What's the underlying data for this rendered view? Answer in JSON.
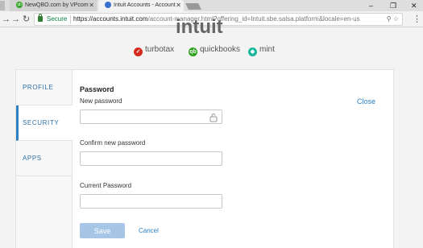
{
  "browser": {
    "tabs": [
      {
        "label": "NewQBO.com by VPcom",
        "favicon": "qb-circle-icon",
        "favicon_text": "qb"
      },
      {
        "label": "Intuit Accounts - Account",
        "favicon": "intuit-circle-icon"
      }
    ],
    "address": {
      "secure_label": "Secure",
      "url_host": "https://accounts.intuit.com",
      "url_rest": "/account-manager.html?offering_id=Intuit.sbe.salsa.platform&locale=en-us"
    }
  },
  "header": {
    "logo_text": "intuit",
    "brands": [
      {
        "name": "turbotax",
        "color": "#d52b1e",
        "icon_glyph": "✓"
      },
      {
        "name": "quickbooks",
        "color": "#2ca01c",
        "icon_glyph": "qb"
      },
      {
        "name": "mint",
        "color": "#1bb79c",
        "icon_glyph": "◆"
      }
    ]
  },
  "sidebar": {
    "items": [
      {
        "label": "PROFILE"
      },
      {
        "label": "SECURITY",
        "active": true
      },
      {
        "label": "APPS"
      }
    ]
  },
  "form": {
    "title": "Password",
    "new_password_label": "New password",
    "confirm_password_label": "Confirm new password",
    "current_password_label": "Current Password",
    "new_password_value": "",
    "confirm_password_value": "",
    "current_password_value": "",
    "close_label": "Close",
    "save_label": "Save",
    "cancel_label": "Cancel"
  },
  "colors": {
    "accent": "#2b80c4",
    "save_disabled": "#a7c6e6"
  }
}
